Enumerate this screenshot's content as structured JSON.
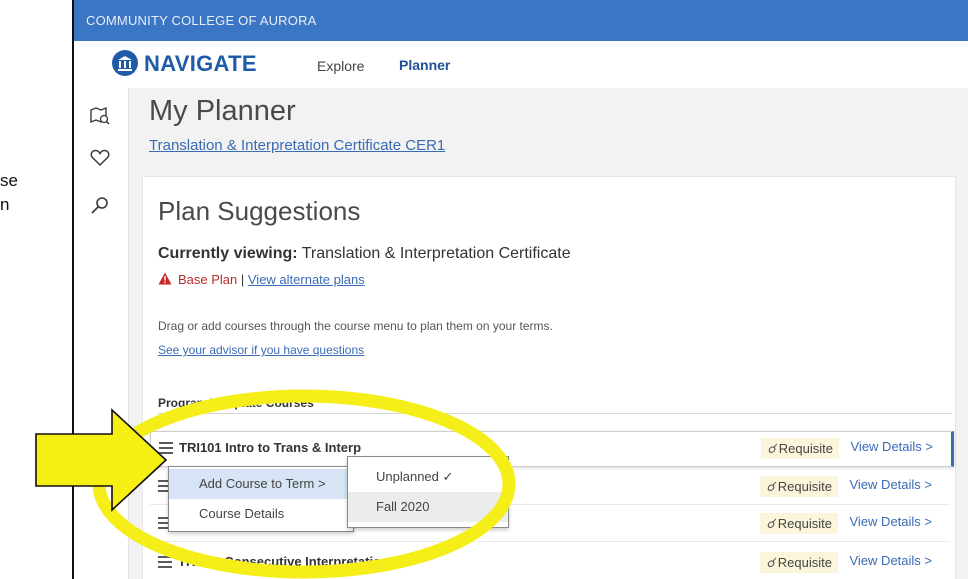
{
  "left_fragments": [
    "se",
    "n"
  ],
  "institution": "COMMUNITY COLLEGE OF AURORA",
  "brand": "NAVIGATE",
  "nav": {
    "explore": "Explore",
    "planner": "Planner"
  },
  "rail_icons": [
    "map-book-icon",
    "heart-icon",
    "search-icon"
  ],
  "page": {
    "title": "My Planner",
    "program_link": "Translation & Interpretation Certificate CER1"
  },
  "suggestions": {
    "title": "Plan Suggestions",
    "viewing_label": "Currently viewing:",
    "viewing_value": " Translation & Interpretation Certificate",
    "base_plan": "Base Plan",
    "separator": " | ",
    "alternate_link": "View alternate plans",
    "help_text": "Drag or add courses through the course menu to plan them on your terms.",
    "advisor_link": "See your advisor if you have questions",
    "section_heading": "Program Template Courses"
  },
  "courses": [
    {
      "name": "TRI101 Intro to Trans & Interp",
      "badge": "Requisite",
      "details": "View Details >"
    },
    {
      "name": "",
      "badge": "Requisite",
      "details": "View Details >"
    },
    {
      "name": "",
      "badge": "Requisite",
      "details": "View Details >"
    },
    {
      "name": "TRI201 Consecutive Interpretation I",
      "badge": "Requisite",
      "details": "View Details >"
    }
  ],
  "menu": {
    "items": [
      "Add Course to Term  >",
      "Course Details"
    ],
    "submenu": [
      "Unplanned ✓",
      "Fall 2020"
    ]
  },
  "colors": {
    "topbar": "#3a76c3",
    "brand": "#1f5ca8",
    "link": "#3a6bb5",
    "arrow_fill": "#f7ee13",
    "ellipse_stroke": "#f5ee19",
    "warning": "#c62828"
  }
}
